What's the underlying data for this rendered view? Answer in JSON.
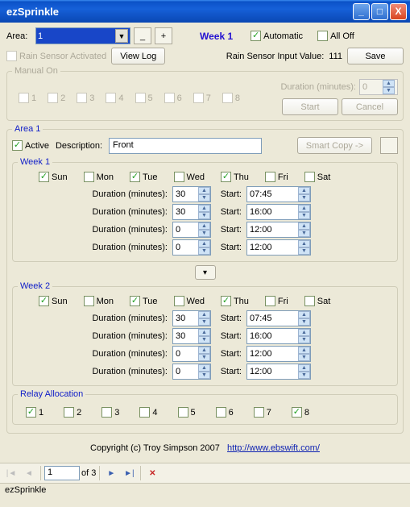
{
  "window": {
    "title": "ezSprinkle"
  },
  "top": {
    "area_label": "Area:",
    "area_value": "1",
    "minus": "_",
    "plus": "+",
    "week_label": "Week 1",
    "automatic_label": "Automatic",
    "automatic_checked": true,
    "alloff_label": "All Off",
    "alloff_checked": false
  },
  "sensor": {
    "rain_activated_label": "Rain Sensor Activated",
    "viewlog_label": "View Log",
    "rain_value_label": "Rain Sensor Input Value:",
    "rain_value": "111",
    "save_label": "Save"
  },
  "manual": {
    "legend": "Manual On",
    "numbers": [
      "1",
      "2",
      "3",
      "4",
      "5",
      "6",
      "7",
      "8"
    ],
    "duration_label": "Duration (minutes):",
    "duration_value": "0",
    "start_label": "Start",
    "cancel_label": "Cancel"
  },
  "area1": {
    "legend": "Area 1",
    "active_label": "Active",
    "active_checked": true,
    "description_label": "Description:",
    "description_value": "Front",
    "smartcopy_label": "Smart Copy ->"
  },
  "days_labels": [
    "Sun",
    "Mon",
    "Tue",
    "Wed",
    "Thu",
    "Fri",
    "Sat"
  ],
  "week1": {
    "legend": "Week 1",
    "days_checked": [
      true,
      false,
      true,
      false,
      true,
      false,
      false
    ],
    "rows": [
      {
        "dur": "30",
        "start": "07:45"
      },
      {
        "dur": "30",
        "start": "16:00"
      },
      {
        "dur": "0",
        "start": "12:00"
      },
      {
        "dur": "0",
        "start": "12:00"
      }
    ]
  },
  "week2": {
    "legend": "Week 2",
    "days_checked": [
      true,
      false,
      true,
      false,
      true,
      false,
      false
    ],
    "rows": [
      {
        "dur": "30",
        "start": "07:45"
      },
      {
        "dur": "30",
        "start": "16:00"
      },
      {
        "dur": "0",
        "start": "12:00"
      },
      {
        "dur": "0",
        "start": "12:00"
      }
    ]
  },
  "common": {
    "duration_label": "Duration (minutes):",
    "start_label": "Start:",
    "collapse_glyph": "▾"
  },
  "relay": {
    "legend": "Relay Allocation",
    "items": [
      {
        "label": "1",
        "checked": true
      },
      {
        "label": "2",
        "checked": false
      },
      {
        "label": "3",
        "checked": false
      },
      {
        "label": "4",
        "checked": false
      },
      {
        "label": "5",
        "checked": false
      },
      {
        "label": "6",
        "checked": false
      },
      {
        "label": "7",
        "checked": false
      },
      {
        "label": "8",
        "checked": true
      }
    ]
  },
  "footer": {
    "copyright": "Copyright (c) Troy Simpson 2007",
    "link": "http://www.ebswift.com/"
  },
  "nav": {
    "page": "1",
    "of_label": "of 3"
  },
  "status": {
    "text": "ezSprinkle"
  }
}
